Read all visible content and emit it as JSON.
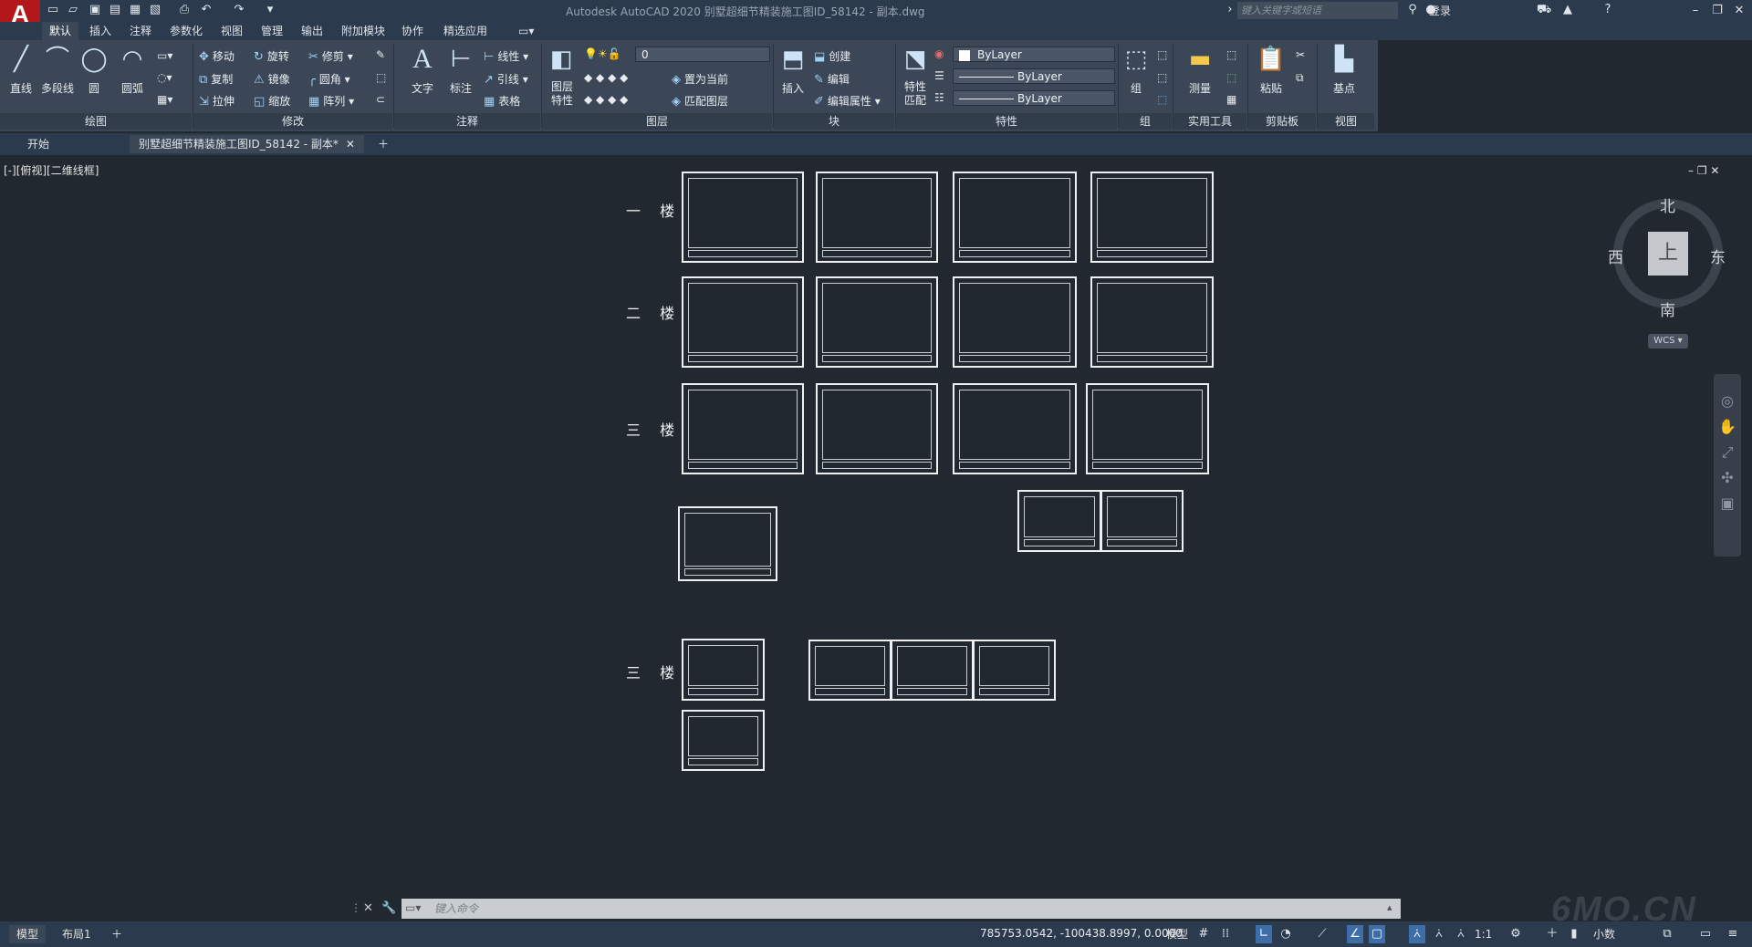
{
  "title_bar": {
    "title": "Autodesk AutoCAD 2020    别墅超细节精装施工图ID_58142 - 副本.dwg",
    "search_placeholder": "键入关键字或短语",
    "login": "登录"
  },
  "ribbon_tabs": [
    "默认",
    "插入",
    "注释",
    "参数化",
    "视图",
    "管理",
    "输出",
    "附加模块",
    "协作",
    "精选应用"
  ],
  "ribbon": {
    "draw": {
      "line": "直线",
      "polyline": "多段线",
      "circle": "圆",
      "arc": "圆弧",
      "label": "绘图"
    },
    "modify": {
      "move": "移动",
      "rotate": "旋转",
      "trim": "修剪",
      "copy": "复制",
      "mirror": "镜像",
      "fillet": "圆角",
      "stretch": "拉伸",
      "scale": "缩放",
      "array": "阵列",
      "label": "修改"
    },
    "annotation": {
      "text": "文字",
      "dimension": "标注",
      "linear": "线性",
      "leader": "引线",
      "table": "表格",
      "label": "注释"
    },
    "layers": {
      "properties": "图层\n特性",
      "current_layer": "0",
      "set_current": "置为当前",
      "match_layer": "匹配图层",
      "label": "图层"
    },
    "block": {
      "insert": "插入",
      "create": "创建",
      "edit": "编辑",
      "edit_attributes": "编辑属性",
      "label": "块"
    },
    "properties": {
      "match": "特性\n匹配",
      "color": "ByLayer",
      "linetype": "ByLayer",
      "lineweight": "ByLayer",
      "label": "特性"
    },
    "groups": {
      "group": "组",
      "label": "组"
    },
    "utilities": {
      "measure": "测量",
      "label": "实用工具"
    },
    "clipboard": {
      "paste": "粘贴",
      "label": "剪贴板"
    },
    "view": {
      "base": "基点",
      "label": "视图"
    }
  },
  "file_tabs": {
    "start": "开始",
    "document": "别墅超细节精装施工图ID_58142 - 副本*"
  },
  "viewport": {
    "label": "[-][俯视][二维线框]"
  },
  "floors": {
    "first": "一 楼",
    "second": "二 楼",
    "third": "三 楼",
    "third_b": "三 楼"
  },
  "viewcube": {
    "north": "北",
    "south": "南",
    "east": "东",
    "west": "西",
    "face": "上",
    "wcs": "WCS"
  },
  "command": {
    "placeholder": "键入命令"
  },
  "status_bar": {
    "model_tab": "模型",
    "layout_tab": "布局1",
    "coords": "785753.0542, -100438.8997, 0.0000",
    "model_btn": "模型",
    "scale": "1:1",
    "units": "小数"
  },
  "watermark": "6MO.CN"
}
